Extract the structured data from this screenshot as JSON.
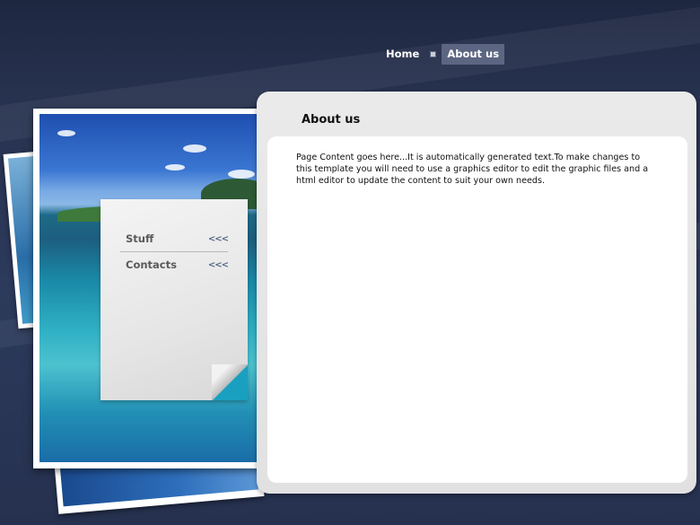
{
  "nav": {
    "items": [
      {
        "label": "Home",
        "active": false
      },
      {
        "label": "About us",
        "active": true
      }
    ],
    "separator_icon": "bullet-square-icon"
  },
  "side_menu": {
    "items": [
      {
        "label": "Stuff",
        "arrow": "<<<"
      },
      {
        "label": "Contacts",
        "arrow": "<<<"
      }
    ]
  },
  "content": {
    "title": "About us",
    "body": "Page Content goes here...It is automatically generated text.To make changes to this template you will need to use a graphics editor to edit the graphic files and a html editor to update the content to suit your own needs."
  },
  "colors": {
    "background": "#27324f",
    "nav_active": "#5c6682",
    "panel": "#e6e6e6"
  }
}
